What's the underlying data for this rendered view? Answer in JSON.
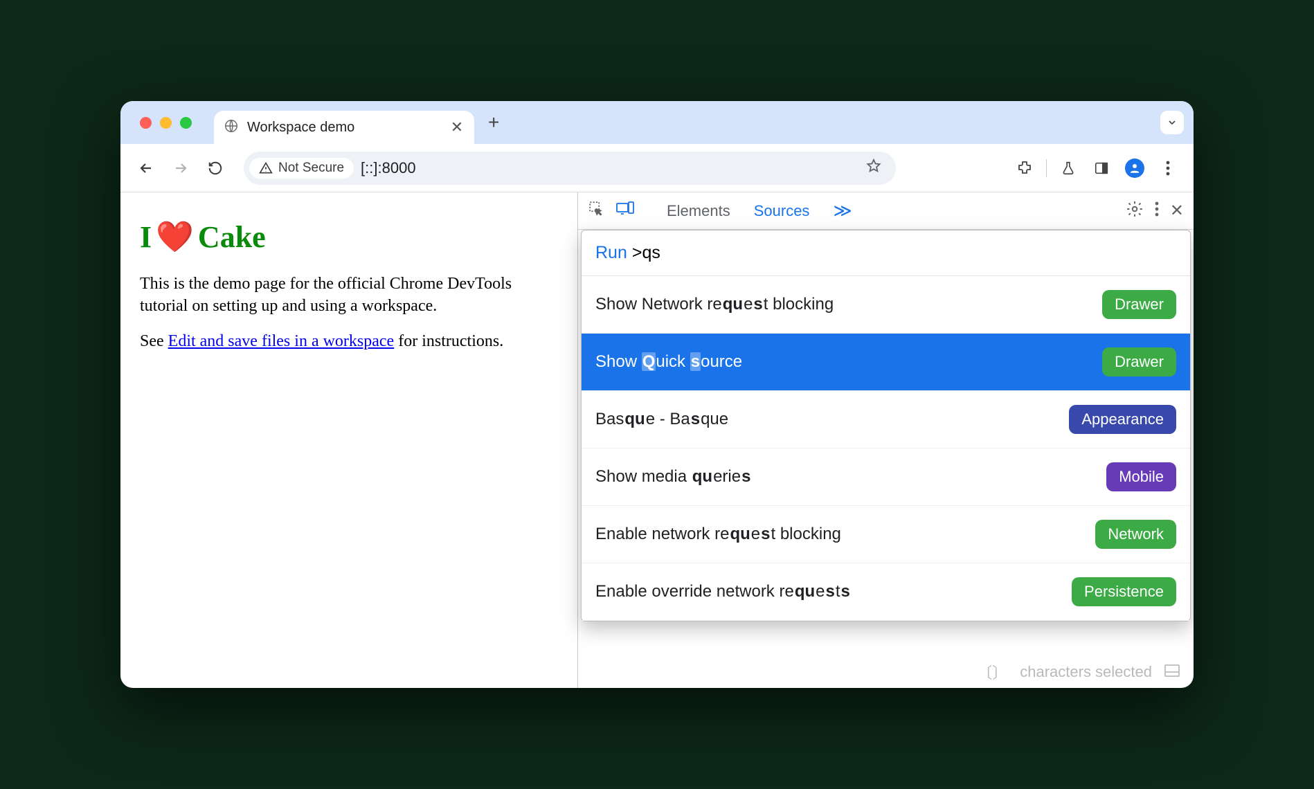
{
  "tab": {
    "title": "Workspace demo"
  },
  "toolbar": {
    "security_label": "Not Secure",
    "url": "[::]:8000"
  },
  "page": {
    "heading_prefix": "I",
    "heading_suffix": "Cake",
    "paragraph": "This is the demo page for the official Chrome DevTools tutorial on setting up and using a workspace.",
    "see_prefix": "See ",
    "link_text": "Edit and save files in a workspace",
    "see_suffix": " for instructions."
  },
  "devtools": {
    "tabs": {
      "elements": "Elements",
      "sources": "Sources",
      "more": "≫"
    },
    "cmd": {
      "run_label": "Run",
      "query_prefix": ">",
      "query": "qs"
    },
    "results": [
      {
        "text_parts": [
          "Show Network re",
          "qu",
          "e",
          "s",
          "t blocking"
        ],
        "badge": "Drawer",
        "badge_color": "b-green",
        "selected": false
      },
      {
        "text_parts": [
          "Show ",
          "Q",
          "uick ",
          "s",
          "ource"
        ],
        "badge": "Drawer",
        "badge_color": "b-green",
        "selected": true
      },
      {
        "text_parts": [
          "Bas",
          "qu",
          "e - Ba",
          "s",
          "que"
        ],
        "badge": "Appearance",
        "badge_color": "b-indigo",
        "selected": false
      },
      {
        "text_parts": [
          "Show media ",
          "qu",
          "erie",
          "s",
          ""
        ],
        "badge": "Mobile",
        "badge_color": "b-purple",
        "selected": false
      },
      {
        "text_parts": [
          "Enable network re",
          "qu",
          "e",
          "s",
          "t blocking"
        ],
        "badge": "Network",
        "badge_color": "b-green",
        "selected": false
      },
      {
        "text_parts": [
          "Enable override network re",
          "qu",
          "e",
          "s",
          "t",
          "s"
        ],
        "badge": "Persistence",
        "badge_color": "b-green",
        "selected": false
      }
    ],
    "drawer_peek": "characters selected"
  }
}
